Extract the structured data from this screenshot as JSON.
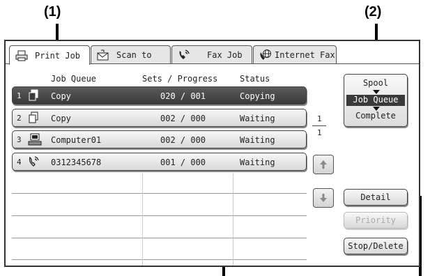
{
  "callouts": {
    "one": "(1)",
    "two": "(2)"
  },
  "tabs": [
    {
      "label": "Print Job",
      "icon": "printer-icon",
      "active": true
    },
    {
      "label": "Scan to",
      "icon": "scan-icon",
      "active": false
    },
    {
      "label": "Fax Job",
      "icon": "fax-phone-icon",
      "active": false
    },
    {
      "label": "Internet Fax",
      "icon": "globe-phone-icon",
      "active": false
    }
  ],
  "columns": {
    "queue": "Job Queue",
    "progress": "Sets / Progress",
    "status": "Status"
  },
  "jobs": [
    {
      "num": "1",
      "icon": "copy-icon",
      "name": "Copy",
      "progress": "020 / 001",
      "status": "Copying",
      "selected": true
    },
    {
      "num": "2",
      "icon": "copy-icon",
      "name": "Copy",
      "progress": "002 / 000",
      "status": "Waiting",
      "selected": false
    },
    {
      "num": "3",
      "icon": "computer-icon",
      "name": "Computer01",
      "progress": "002 / 000",
      "status": "Waiting",
      "selected": false
    },
    {
      "num": "4",
      "icon": "phone-icon",
      "name": "0312345678",
      "progress": "001 / 000",
      "status": "Waiting",
      "selected": false
    }
  ],
  "pager": {
    "current": "1",
    "total": "1"
  },
  "spool": {
    "spool": "Spool",
    "job_queue": "Job Queue",
    "complete": "Complete"
  },
  "buttons": {
    "detail": "Detail",
    "priority": "Priority",
    "stop_delete": "Stop/Delete"
  }
}
